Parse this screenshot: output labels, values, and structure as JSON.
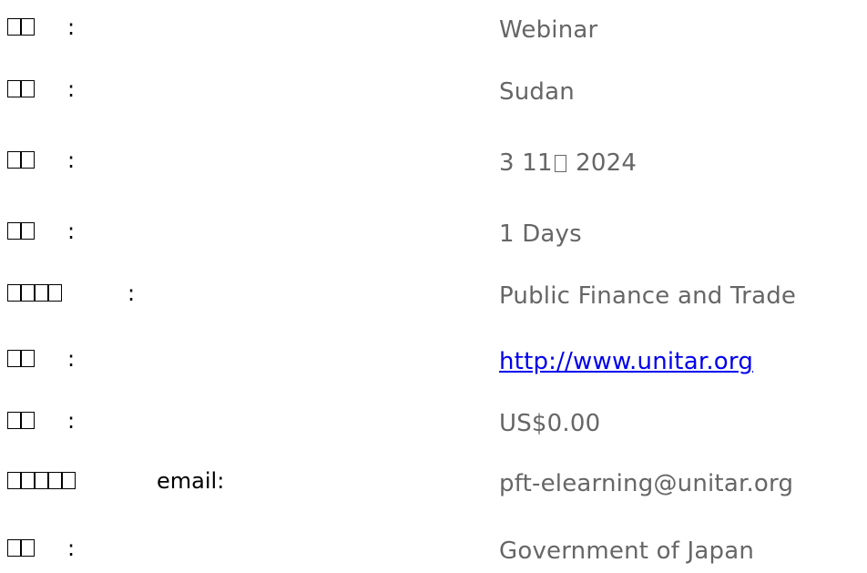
{
  "rows": [
    {
      "label_glyphs": 2,
      "separator": ":",
      "value": "Webinar"
    },
    {
      "label_glyphs": 2,
      "separator": ":",
      "value": "Sudan"
    },
    {
      "label_glyphs": 2,
      "separator": ":",
      "value_pre": "3 11",
      "value_post": " 2024"
    },
    {
      "label_glyphs": 2,
      "separator": ":",
      "value": "1 Days"
    },
    {
      "label_glyphs": 4,
      "separator": ":",
      "value": "Public Finance and Trade"
    },
    {
      "label_glyphs": 2,
      "separator": ":",
      "value": "http://www.unitar.org"
    },
    {
      "label_glyphs": 2,
      "separator": ":",
      "value": "US$0.00"
    },
    {
      "label_glyphs": 5,
      "separator": "email:",
      "value": "pft-elearning@unitar.org"
    },
    {
      "label_glyphs": 2,
      "separator": ":",
      "value": "Government of Japan"
    }
  ]
}
